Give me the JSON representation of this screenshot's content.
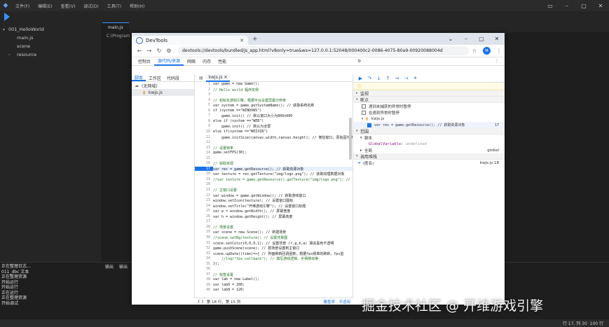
{
  "ide": {
    "menu": [
      "文件(F)",
      "编辑(E)",
      "查看(V)",
      "调试(D)",
      "工具(T)",
      "帮助(H)"
    ],
    "tree": [
      {
        "label": "001_HelloWorld",
        "level": 0,
        "chevron": "▾"
      },
      {
        "label": "main.js",
        "level": 1,
        "chevron": ""
      },
      {
        "label": "scene",
        "level": 1,
        "chevron": ""
      },
      {
        "label": "resource",
        "level": 1,
        "chevron": "›"
      }
    ],
    "editor_tab": "main.js",
    "editor_path": "C:\\Program F",
    "bottom_tabs": [
      "输出",
      "输出"
    ],
    "log_lines": [
      "正在整理日志…",
      "011_dbc 文本",
      "正在整理资源",
      "开始运行",
      "开始运行",
      "正在运行",
      "正在整理资源",
      "开始调试"
    ],
    "status_pos": "行 17, 列 30",
    "status_zoom": "100 行"
  },
  "devtools": {
    "tab_title": "DevTools",
    "url": "devtools://devtools/bundled/js_app.html?v8only=true&ws=127.0.0.1:52048/000400c2-0086-4075-80a9-00920088004d",
    "avatar": "M",
    "panels": [
      "控制台",
      "源代码/来源",
      "网络",
      "内存",
      "性能"
    ],
    "active_panel": "源代码/来源",
    "nav_tabs": [
      "脚本",
      "工作区",
      "代码段"
    ],
    "nav_tree": [
      {
        "label": "(无网域)",
        "level": 0
      },
      {
        "label": "kwjs.js",
        "level": 1
      }
    ],
    "file_tab": "kwjs.js",
    "code": [
      {
        "n": 1,
        "t": "var game = new Game();"
      },
      {
        "n": 2,
        "t": "// Hello world 程序实例"
      },
      {
        "n": 3,
        "t": ""
      },
      {
        "n": 4,
        "t": "// 初始化游戏引擎，根据平台设置屏幕分辨率"
      },
      {
        "n": 5,
        "t": "var system = game.getSystemName(); // 获取系统名称"
      },
      {
        "n": 6,
        "t": "if (system ==\"WINDOWS\")"
      },
      {
        "n": 7,
        "t": "    game.init() // 默认窗口大小为800x600"
      },
      {
        "n": 8,
        "t": "else if (system ==\"WEB\")"
      },
      {
        "n": 9,
        "t": "    game.init() // 默认为全屏"
      },
      {
        "n": 10,
        "t": "else if(system ==\"WEIXIN\")"
      },
      {
        "n": 11,
        "t": "    game.initSize(canvas.width,canvas.height); // 微信窗口，原始因为刷"
      },
      {
        "n": 12,
        "t": ""
      },
      {
        "n": 13,
        "t": "// 设置帧率"
      },
      {
        "n": 14,
        "t": "game.setFPS(30);"
      },
      {
        "n": 15,
        "t": ""
      },
      {
        "n": 16,
        "t": "// 获取资源"
      },
      {
        "n": 17,
        "t": "var res = game.getResource(); // 获取资源对象"
      },
      {
        "n": 18,
        "t": "var texture = res.getTexture(\"img/logo.png\"); // 获取纹理数据对象"
      },
      {
        "n": 19,
        "t": "//var texture = game.getResource().getTexture(\"img/logo.png\"); // 另一"
      },
      {
        "n": 20,
        "t": ""
      },
      {
        "n": 21,
        "t": "// 主窗口设置"
      },
      {
        "n": 22,
        "t": "var window = game.getWindow(); // 获取游戏窗口"
      },
      {
        "n": 23,
        "t": "window.setIcon(texture); // 设置窗口图标"
      },
      {
        "n": 24,
        "t": "window.setTitle(\"开维游戏引擎\"); // 设置窗口标题"
      },
      {
        "n": 25,
        "t": "var w = window.getWidth(); // 屏幕宽度"
      },
      {
        "n": 26,
        "t": "var h = window.getHeight(); // 屏幕高度"
      },
      {
        "n": 27,
        "t": ""
      },
      {
        "n": 28,
        "t": "// 场景设置"
      },
      {
        "n": 29,
        "t": "var scene = new Scene(); // 新建场景"
      },
      {
        "n": 30,
        "t": "//scene.setBg(texture); // 设置背景图"
      },
      {
        "n": 31,
        "t": "scene.setColor(0,0,0,1); // 设置背景 (r,g,b,a) 填充黑色不透明"
      },
      {
        "n": 32,
        "t": "game.pushScene(scene); // 把场景设置到主窗口"
      },
      {
        "n": 33,
        "t": "scene.upDate((time)=>{ // 界面刷新回调函数，根据fps频率的刷新，fps监"
      },
      {
        "n": 34,
        "t": "    //log(\"fps callback\"); // 填写游戏逻辑、手柄移动等"
      },
      {
        "n": 35,
        "t": "});"
      },
      {
        "n": 36,
        "t": ""
      },
      {
        "n": 37,
        "t": "// 标签设置"
      },
      {
        "n": 38,
        "t": "var lab = new Label();"
      },
      {
        "n": 39,
        "t": "var lab0 = 200;"
      },
      {
        "n": 40,
        "t": "var lab8 = 120;"
      }
    ],
    "breakpoint_line": 17,
    "editor_status": "第 18 行，第 15 列",
    "coverage": "覆盖率：不适用",
    "paused_text": "调试程序已暂停",
    "sections": {
      "watch": "监视",
      "breakpoints": "断点",
      "pause_uncaught": "遇到未捕获的异常时暂停",
      "pause_caught": "在遇到异常时暂停",
      "bp_file": "kwjs.js",
      "bp_code": "var res = game.getResource(); // 获取资源对象",
      "bp_line": "17",
      "scope": "范围",
      "local": "脚本",
      "scope_var": "GlobalVariable",
      "scope_val": "undefined",
      "global": "全局",
      "global_val": "global",
      "callstack": "调用堆栈",
      "frame": "(匿名)",
      "frame_loc": "kwjs.js:18"
    }
  },
  "watermark": "掘金技术社区 @ 开维游戏引擎"
}
